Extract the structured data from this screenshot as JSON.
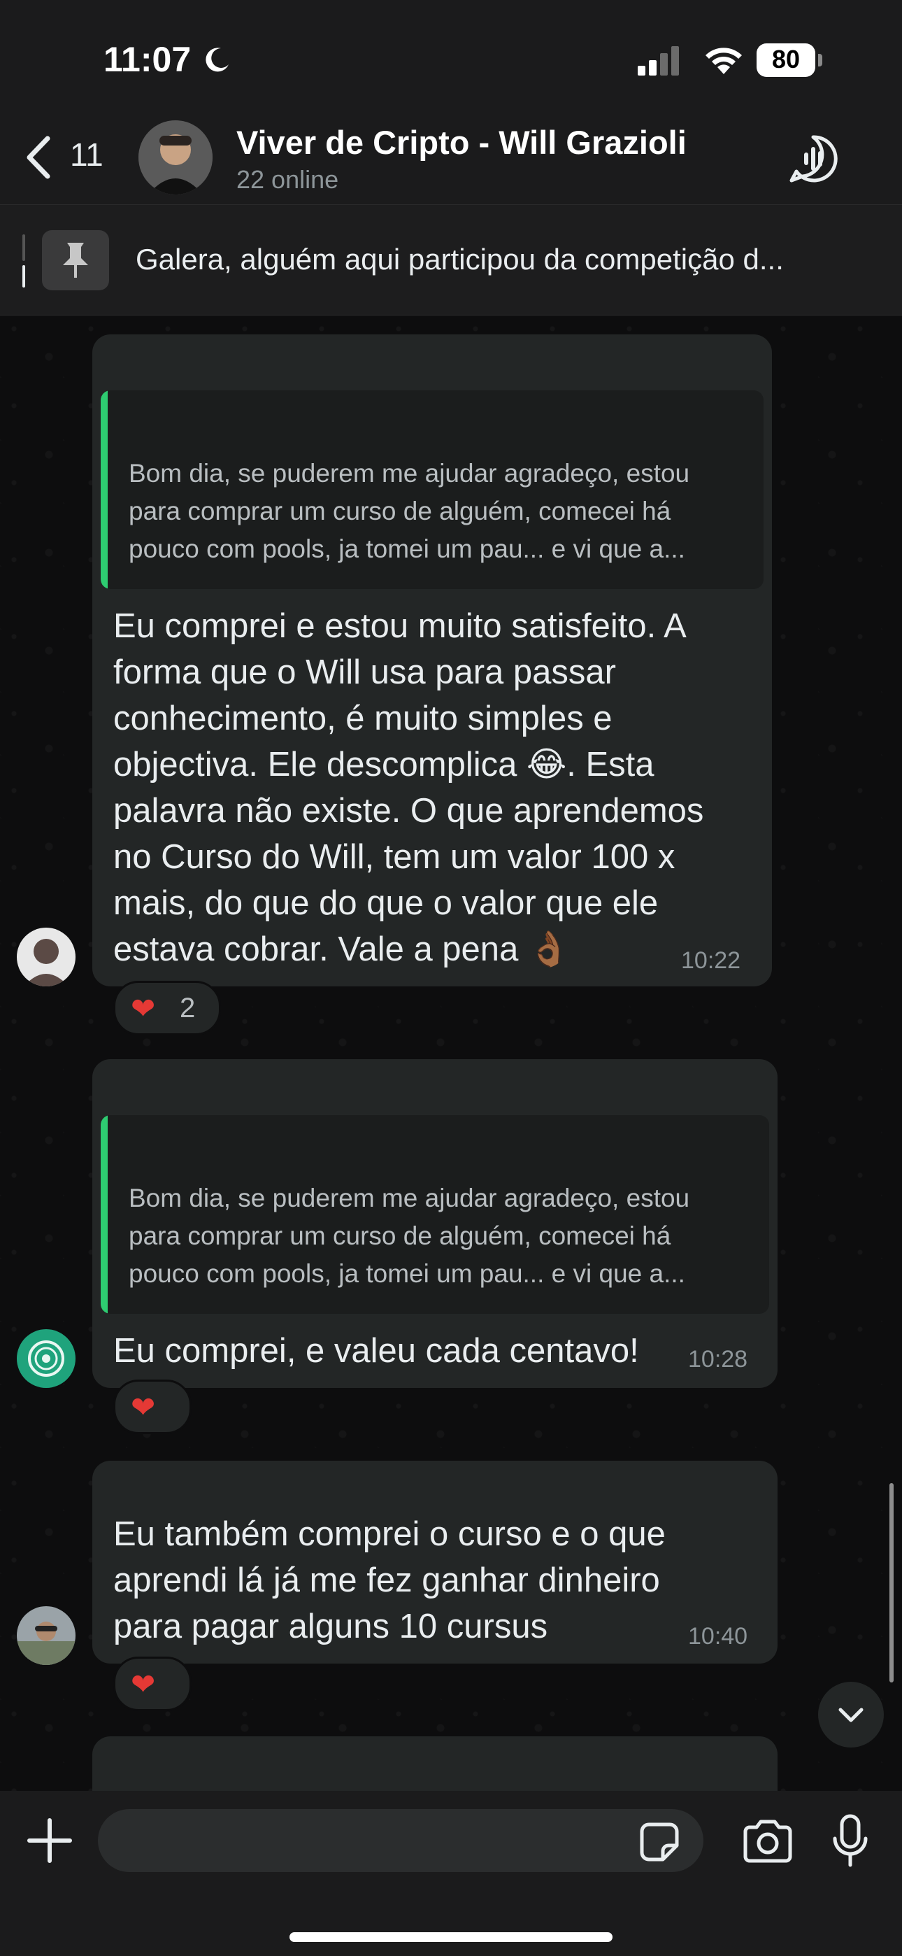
{
  "status_bar": {
    "time": "11:07",
    "battery": "80"
  },
  "header": {
    "back_count": "11",
    "title": "Viver de Cripto - Will Grazioli",
    "subtitle": "22 online"
  },
  "pinned": {
    "text": "Galera, alguém aqui participou da competição d..."
  },
  "messages": [
    {
      "quote": [
        "Bom dia, se puderem me ajudar agradeço, estou",
        "para comprar um curso de alguém, comecei há",
        "pouco com pools, ja tomei um pau... e vi que a..."
      ],
      "text": [
        "Eu comprei e estou muito satisfeito. A",
        "forma que o Will usa para passar",
        "conhecimento, é muito simples e",
        "objectiva. Ele descomplica 😂. Esta",
        "palavra não existe. O que aprendemos",
        "no Curso do Will, tem um valor 100 x",
        "mais, do que do que o valor que ele",
        "estava cobrar. Vale a pena 👌🏾"
      ],
      "time": "10:22",
      "reaction": {
        "emoji": "❤",
        "count": "2"
      }
    },
    {
      "quote": [
        "Bom dia, se puderem me ajudar agradeço, estou",
        "para comprar um curso de alguém, comecei há",
        "pouco com pools, ja tomei um pau... e vi que a..."
      ],
      "text": [
        "Eu comprei, e valeu cada centavo!"
      ],
      "time": "10:28",
      "reaction": {
        "emoji": "❤",
        "count": ""
      }
    },
    {
      "text": [
        "Eu também comprei o curso e o que",
        "aprendi lá já me fez ganhar dinheiro",
        "para pagar alguns 10 cursus"
      ],
      "time": "10:40",
      "reaction": {
        "emoji": "❤",
        "count": ""
      }
    }
  ],
  "colors": {
    "accent": "#2ecc71",
    "bubble": "#232626",
    "background": "#0d0d0e"
  },
  "icons": [
    "moon-icon",
    "signal-icon",
    "wifi-icon",
    "chevron-left-icon",
    "voice-call-icon",
    "pin-icon",
    "heart-icon",
    "chevron-down-icon",
    "plus-icon",
    "sticker-icon",
    "camera-icon",
    "mic-icon"
  ]
}
